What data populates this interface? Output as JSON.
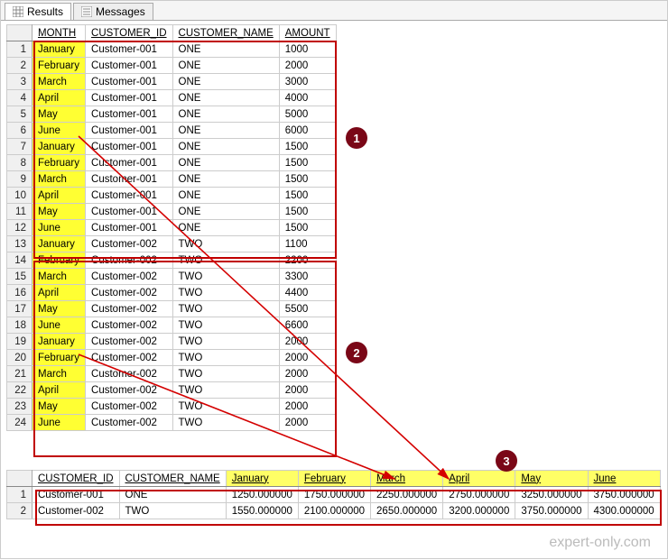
{
  "tabs": {
    "results": "Results",
    "messages": "Messages"
  },
  "grid1": {
    "headers": {
      "month": "MONTH",
      "cust_id": "CUSTOMER_ID",
      "cust_name": "CUSTOMER_NAME",
      "amount": "AMOUNT"
    },
    "rows": [
      {
        "n": "1",
        "month": "January",
        "cid": "Customer-001",
        "cname": "ONE",
        "amt": "1000"
      },
      {
        "n": "2",
        "month": "February",
        "cid": "Customer-001",
        "cname": "ONE",
        "amt": "2000"
      },
      {
        "n": "3",
        "month": "March",
        "cid": "Customer-001",
        "cname": "ONE",
        "amt": "3000"
      },
      {
        "n": "4",
        "month": "April",
        "cid": "Customer-001",
        "cname": "ONE",
        "amt": "4000"
      },
      {
        "n": "5",
        "month": "May",
        "cid": "Customer-001",
        "cname": "ONE",
        "amt": "5000"
      },
      {
        "n": "6",
        "month": "June",
        "cid": "Customer-001",
        "cname": "ONE",
        "amt": "6000"
      },
      {
        "n": "7",
        "month": "January",
        "cid": "Customer-001",
        "cname": "ONE",
        "amt": "1500"
      },
      {
        "n": "8",
        "month": "February",
        "cid": "Customer-001",
        "cname": "ONE",
        "amt": "1500"
      },
      {
        "n": "9",
        "month": "March",
        "cid": "Customer-001",
        "cname": "ONE",
        "amt": "1500"
      },
      {
        "n": "10",
        "month": "April",
        "cid": "Customer-001",
        "cname": "ONE",
        "amt": "1500"
      },
      {
        "n": "11",
        "month": "May",
        "cid": "Customer-001",
        "cname": "ONE",
        "amt": "1500"
      },
      {
        "n": "12",
        "month": "June",
        "cid": "Customer-001",
        "cname": "ONE",
        "amt": "1500"
      },
      {
        "n": "13",
        "month": "January",
        "cid": "Customer-002",
        "cname": "TWO",
        "amt": "1100"
      },
      {
        "n": "14",
        "month": "February",
        "cid": "Customer-002",
        "cname": "TWO",
        "amt": "2200"
      },
      {
        "n": "15",
        "month": "March",
        "cid": "Customer-002",
        "cname": "TWO",
        "amt": "3300"
      },
      {
        "n": "16",
        "month": "April",
        "cid": "Customer-002",
        "cname": "TWO",
        "amt": "4400"
      },
      {
        "n": "17",
        "month": "May",
        "cid": "Customer-002",
        "cname": "TWO",
        "amt": "5500"
      },
      {
        "n": "18",
        "month": "June",
        "cid": "Customer-002",
        "cname": "TWO",
        "amt": "6600"
      },
      {
        "n": "19",
        "month": "January",
        "cid": "Customer-002",
        "cname": "TWO",
        "amt": "2000"
      },
      {
        "n": "20",
        "month": "February",
        "cid": "Customer-002",
        "cname": "TWO",
        "amt": "2000"
      },
      {
        "n": "21",
        "month": "March",
        "cid": "Customer-002",
        "cname": "TWO",
        "amt": "2000"
      },
      {
        "n": "22",
        "month": "April",
        "cid": "Customer-002",
        "cname": "TWO",
        "amt": "2000"
      },
      {
        "n": "23",
        "month": "May",
        "cid": "Customer-002",
        "cname": "TWO",
        "amt": "2000"
      },
      {
        "n": "24",
        "month": "June",
        "cid": "Customer-002",
        "cname": "TWO",
        "amt": "2000"
      }
    ]
  },
  "grid2": {
    "headers": {
      "cust_id": "CUSTOMER_ID",
      "cust_name": "CUSTOMER_NAME",
      "jan": "January",
      "feb": "February",
      "mar": "March",
      "apr": "April",
      "may": "May",
      "jun": "June"
    },
    "rows": [
      {
        "n": "1",
        "cid": "Customer-001",
        "cname": "ONE",
        "jan": "1250.000000",
        "feb": "1750.000000",
        "mar": "2250.000000",
        "apr": "2750.000000",
        "may": "3250.000000",
        "jun": "3750.000000"
      },
      {
        "n": "2",
        "cid": "Customer-002",
        "cname": "TWO",
        "jan": "1550.000000",
        "feb": "2100.000000",
        "mar": "2650.000000",
        "apr": "3200.000000",
        "may": "3750.000000",
        "jun": "4300.000000"
      }
    ]
  },
  "badges": {
    "b1": "1",
    "b2": "2",
    "b3": "3"
  },
  "watermark": "expert-only.com"
}
